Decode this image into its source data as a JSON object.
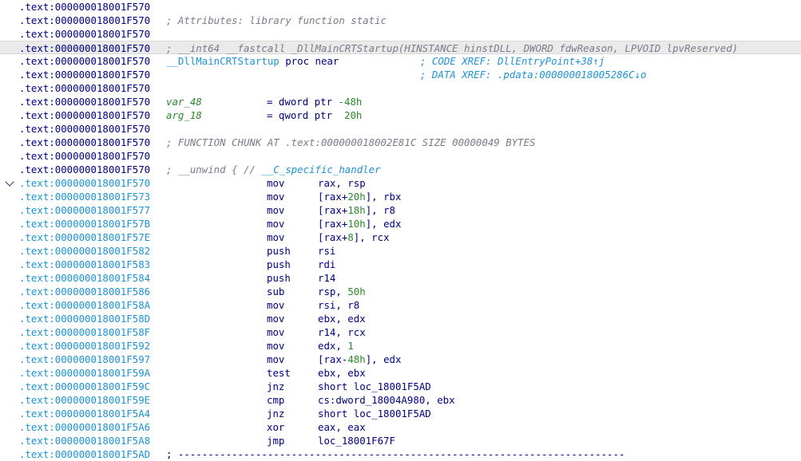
{
  "header_rows": [
    {
      "addr": ".text:000000018001F570",
      "text": ""
    },
    {
      "addr": ".text:000000018001F570",
      "comment": "; Attributes: library function static"
    },
    {
      "addr": ".text:000000018001F570",
      "text": ""
    },
    {
      "addr": ".text:000000018001F570",
      "comment": "; __int64 __fastcall _DllMainCRTStartup(HINSTANCE hinstDLL, DWORD fdwReason, LPVOID lpvReserved)"
    },
    {
      "addr": ".text:000000018001F570",
      "proc_name": "__DllMainCRTStartup",
      "proc_kw": " proc near",
      "xref": "; CODE XREF: DllEntryPoint+38↑j"
    },
    {
      "addr": ".text:000000018001F570",
      "xref": "; DATA XREF: .pdata:000000018005286C↓o"
    },
    {
      "addr": ".text:000000018001F570",
      "text": ""
    },
    {
      "addr": ".text:000000018001F570",
      "var": "var_48",
      "def": "= dword ptr ",
      "val": "-48h"
    },
    {
      "addr": ".text:000000018001F570",
      "var": "arg_18",
      "def": "= qword ptr  ",
      "val": "20h"
    },
    {
      "addr": ".text:000000018001F570",
      "text": ""
    },
    {
      "addr": ".text:000000018001F570",
      "comment": "; FUNCTION CHUNK AT .text:000000018002E81C SIZE 00000049 BYTES"
    },
    {
      "addr": ".text:000000018001F570",
      "text": ""
    },
    {
      "addr": ".text:000000018001F570",
      "comment_a": "; __unwind { // ",
      "comment_b": "__C_specific_handler"
    }
  ],
  "instructions": [
    {
      "addr": ".text:000000018001F570",
      "mn": "mov",
      "ops_a": "rax, rsp",
      "ops_num": "",
      "ops_b": ""
    },
    {
      "addr": ".text:000000018001F573",
      "mn": "mov",
      "ops_a": "[rax+",
      "ops_num": "20h",
      "ops_b": "], rbx"
    },
    {
      "addr": ".text:000000018001F577",
      "mn": "mov",
      "ops_a": "[rax+",
      "ops_num": "18h",
      "ops_b": "], r8"
    },
    {
      "addr": ".text:000000018001F57B",
      "mn": "mov",
      "ops_a": "[rax+",
      "ops_num": "10h",
      "ops_b": "], edx"
    },
    {
      "addr": ".text:000000018001F57E",
      "mn": "mov",
      "ops_a": "[rax+",
      "ops_num": "8",
      "ops_b": "], rcx"
    },
    {
      "addr": ".text:000000018001F582",
      "mn": "push",
      "ops_a": "rsi",
      "ops_num": "",
      "ops_b": ""
    },
    {
      "addr": ".text:000000018001F583",
      "mn": "push",
      "ops_a": "rdi",
      "ops_num": "",
      "ops_b": ""
    },
    {
      "addr": ".text:000000018001F584",
      "mn": "push",
      "ops_a": "r14",
      "ops_num": "",
      "ops_b": ""
    },
    {
      "addr": ".text:000000018001F586",
      "mn": "sub",
      "ops_a": "rsp, ",
      "ops_num": "50h",
      "ops_b": ""
    },
    {
      "addr": ".text:000000018001F58A",
      "mn": "mov",
      "ops_a": "rsi, r8",
      "ops_num": "",
      "ops_b": ""
    },
    {
      "addr": ".text:000000018001F58D",
      "mn": "mov",
      "ops_a": "ebx, edx",
      "ops_num": "",
      "ops_b": ""
    },
    {
      "addr": ".text:000000018001F58F",
      "mn": "mov",
      "ops_a": "r14, rcx",
      "ops_num": "",
      "ops_b": ""
    },
    {
      "addr": ".text:000000018001F592",
      "mn": "mov",
      "ops_a": "edx, ",
      "ops_num": "1",
      "ops_b": ""
    },
    {
      "addr": ".text:000000018001F597",
      "mn": "mov",
      "ops_a": "[rax-",
      "ops_num": "48h",
      "ops_b": "], edx"
    },
    {
      "addr": ".text:000000018001F59A",
      "mn": "test",
      "ops_a": "ebx, ebx",
      "ops_num": "",
      "ops_b": ""
    },
    {
      "addr": ".text:000000018001F59C",
      "mn": "jnz",
      "ops_a": "short loc_18001F5AD",
      "ops_num": "",
      "ops_b": ""
    },
    {
      "addr": ".text:000000018001F59E",
      "mn": "cmp",
      "ops_a": "cs:dword_18004A980, ebx",
      "ops_num": "",
      "ops_b": ""
    },
    {
      "addr": ".text:000000018001F5A4",
      "mn": "jnz",
      "ops_a": "short loc_18001F5AD",
      "ops_num": "",
      "ops_b": ""
    },
    {
      "addr": ".text:000000018001F5A6",
      "mn": "xor",
      "ops_a": "eax, eax",
      "ops_num": "",
      "ops_b": ""
    },
    {
      "addr": ".text:000000018001F5A8",
      "mn": "jmp",
      "ops_a": "loc_18001F67F",
      "ops_num": "",
      "ops_b": ""
    }
  ],
  "footer_row": {
    "addr": ".text:000000018001F5AD",
    "divider": "; ---------------------------------------------------------------------------"
  },
  "colors": {
    "address": "#000080",
    "code_address": "#1d93d4",
    "comment": "#7a7a8a",
    "number": "#2a8a2a",
    "highlight": "#eaeaea"
  }
}
